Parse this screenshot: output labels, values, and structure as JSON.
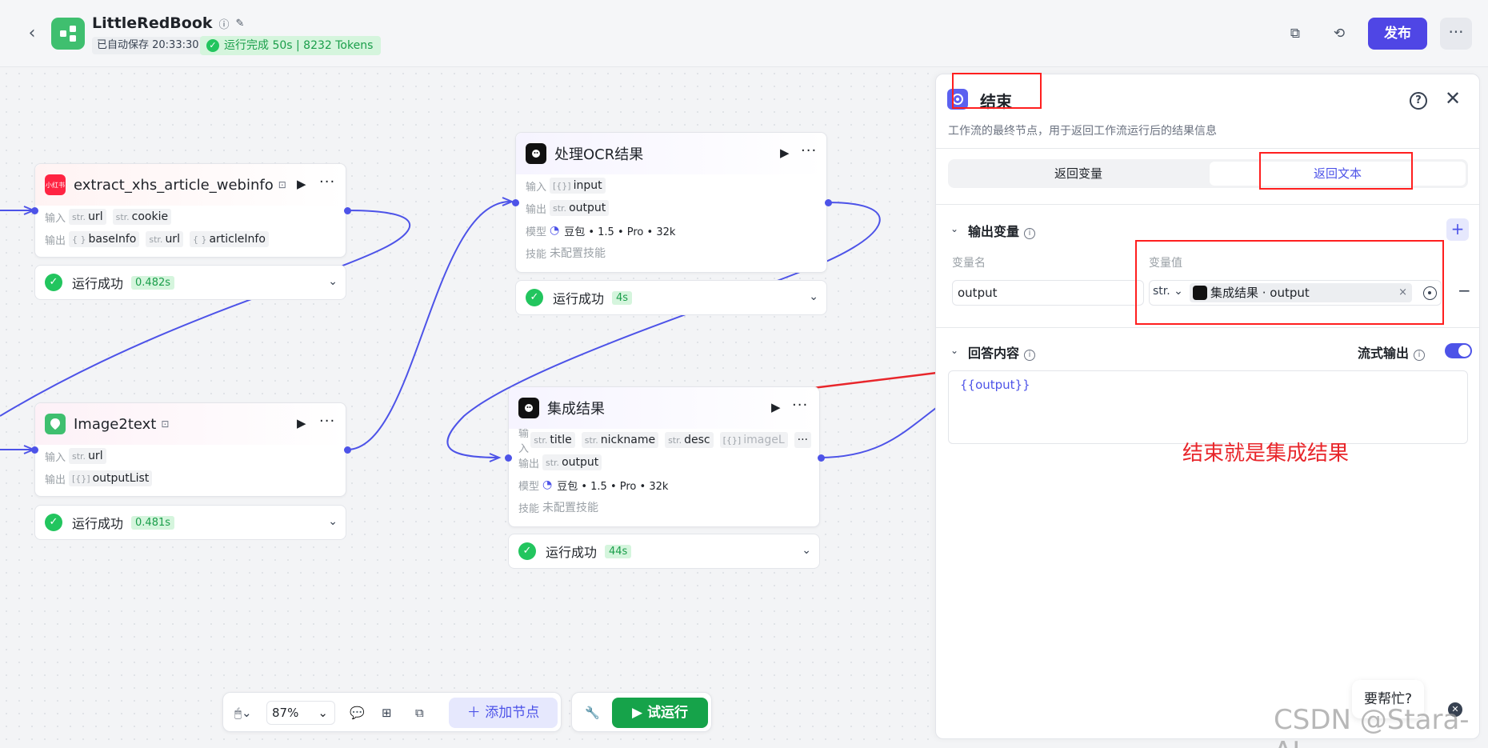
{
  "header": {
    "back_icon": "chevron-left-icon",
    "app_name": "LittleRedBook",
    "autosave": "已自动保存 20:33:30",
    "run_status": "运行完成 50s | 8232 Tokens",
    "publish_label": "发布",
    "more_label": "···"
  },
  "nodes": {
    "extract": {
      "title": "extract_xhs_article_webinfo",
      "icon_text": "小红书",
      "in_label": "输入",
      "out_label": "输出",
      "inputs": [
        {
          "type": "str.",
          "name": "url"
        },
        {
          "type": "str.",
          "name": "cookie"
        }
      ],
      "outputs": [
        {
          "type": "{ }",
          "name": "baseInfo"
        },
        {
          "type": "str.",
          "name": "url"
        },
        {
          "type": "{ }",
          "name": "articleInfo"
        }
      ],
      "status": "运行成功",
      "time": "0.482s"
    },
    "image2text": {
      "title": "Image2text",
      "in_label": "输入",
      "out_label": "输出",
      "inputs": [
        {
          "type": "str.",
          "name": "url"
        }
      ],
      "outputs": [
        {
          "type": "[{}]",
          "name": "outputList"
        }
      ],
      "status": "运行成功",
      "time": "0.481s"
    },
    "ocr": {
      "title": "处理OCR结果",
      "in_label": "输入",
      "out_label": "输出",
      "model_label": "模型",
      "skill_label": "技能",
      "inputs": [
        {
          "type": "[{}]",
          "name": "input"
        }
      ],
      "outputs": [
        {
          "type": "str.",
          "name": "output"
        }
      ],
      "model": "豆包 • 1.5 • Pro • 32k",
      "skill": "未配置技能",
      "status": "运行成功",
      "time": "4s"
    },
    "merge": {
      "title": "集成结果",
      "in_label": "输入",
      "out_label": "输出",
      "model_label": "模型",
      "skill_label": "技能",
      "inputs": [
        {
          "type": "str.",
          "name": "title"
        },
        {
          "type": "str.",
          "name": "nickname"
        },
        {
          "type": "str.",
          "name": "desc"
        },
        {
          "type": "[{}]",
          "name": "imageL"
        }
      ],
      "outputs": [
        {
          "type": "str.",
          "name": "output"
        }
      ],
      "model": "豆包 • 1.5 • Pro • 32k",
      "skill": "未配置技能",
      "status": "运行成功",
      "time": "44s"
    }
  },
  "toolbar": {
    "zoom": "87%",
    "add_node": "添加节点",
    "trial_run": "试运行"
  },
  "panel": {
    "title": "结束",
    "description": "工作流的最终节点，用于返回工作流运行后的结果信息",
    "tabs": [
      "返回变量",
      "返回文本"
    ],
    "active_tab": 1,
    "output_section": "输出变量",
    "col_name": "变量名",
    "col_value": "变量值",
    "var_name": "output",
    "var_type": "str.",
    "var_ref": "集成结果 · output",
    "answer_section": "回答内容",
    "stream_label": "流式输出",
    "answer_text": "{{output}}"
  },
  "annotation": "结束就是集成结果",
  "help": "要帮忙?",
  "watermark": "CSDN @Stara-AI",
  "colors": {
    "accent": "#4d53e8",
    "success": "#22c55e",
    "annotation": "#ff1f1f",
    "publish": "#4f46e5"
  }
}
